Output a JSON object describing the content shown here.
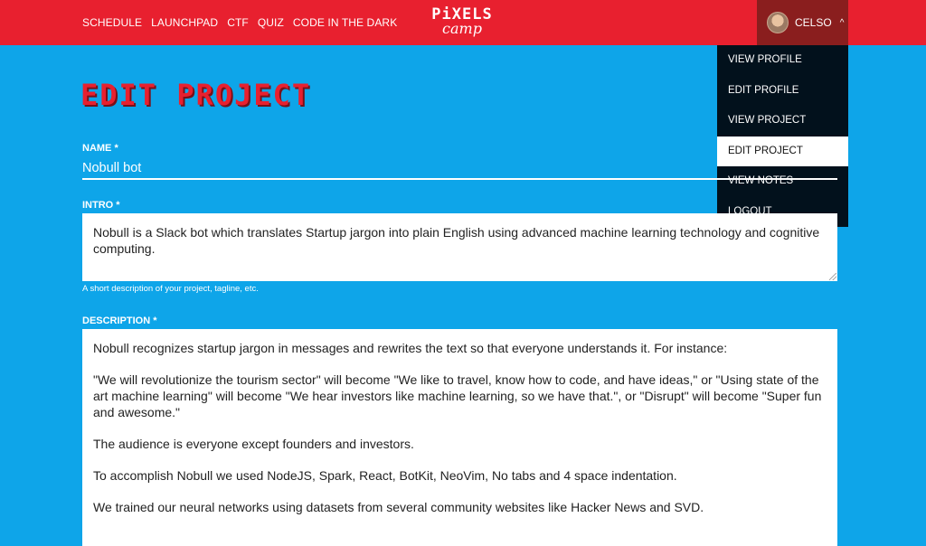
{
  "header": {
    "nav": [
      "SCHEDULE",
      "LAUNCHPAD",
      "CTF",
      "QUIZ",
      "CODE IN THE DARK"
    ],
    "logo_top": "PiXELS",
    "logo_bottom": "camp",
    "user_name": "CELSO",
    "chevron": "^"
  },
  "user_menu": {
    "items": [
      "VIEW PROFILE",
      "EDIT PROFILE",
      "VIEW PROJECT",
      "EDIT PROJECT",
      "VIEW NOTES",
      "LOGOUT"
    ],
    "active": "EDIT PROJECT"
  },
  "page": {
    "title": "EDIT PROJECT"
  },
  "form": {
    "name_label": "NAME *",
    "name_value": "Nobull bot",
    "intro_label": "INTRO *",
    "intro_value": "Nobull is a Slack bot which translates Startup jargon into plain English using advanced machine learning technology and cognitive computing.",
    "intro_hint": "A short description of your project, tagline, etc.",
    "description_label": "DESCRIPTION *",
    "description_paragraphs": [
      "Nobull recognizes startup jargon in messages and rewrites the text so that everyone understands it. For instance:",
      "\"We will revolutionize the tourism sector\" will become \"We like to travel, know how to code, and have ideas,\" or \"Using state of the art machine learning\" will become \"We hear investors like machine learning, so we have that.\", or \"Disrupt\" will become \"Super fun and awesome.\"",
      "The audience is everyone except founders and investors.",
      "To accomplish Nobull we used NodeJS, Spark, React, BotKit, NeoVim, No tabs and 4 space indentation.",
      "We trained our neural networks using datasets from several community websites like Hacker News and SVD."
    ]
  },
  "colors": {
    "background": "#0ea5e9",
    "header": "#e8202f",
    "user_trigger": "#8a1e1e",
    "menu": "#02111c"
  },
  "icons": {
    "chevron": "chevron-up-icon",
    "resize": "resize-handle-icon"
  }
}
